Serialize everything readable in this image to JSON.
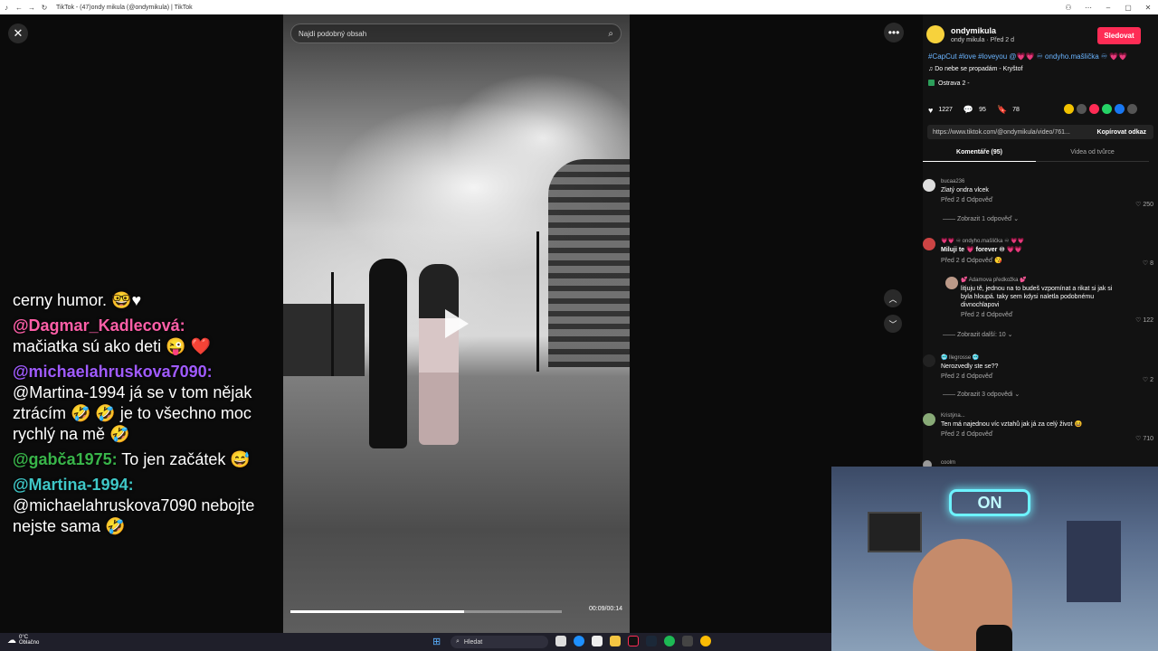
{
  "browser": {
    "title": "TikTok - (47)ondy mikula (@ondymikula) | TikTok"
  },
  "chat": [
    {
      "user": "",
      "text": "cerny humor. 🤓♥",
      "color": "#ffffff"
    },
    {
      "user": "@Dagmar_Kadlecová:",
      "text": "mačiatka sú ako deti 😜 ❤️",
      "color": "#ff5fa8"
    },
    {
      "user": "@michaelahruskova7090:",
      "text": " @Martina-1994 já se v tom nějak ztrácím 🤣 🤣 je to všechno moc rychlý na mě 🤣",
      "color": "#a05bff"
    },
    {
      "user": "@gabča1975:",
      "text": " To jen začátek 😅",
      "color": "#39b54a"
    },
    {
      "user": "@Martina-1994:",
      "text": " @michaelahruskova7090 nebojte nejste sama 🤣",
      "color": "#3fc7c7"
    }
  ],
  "video": {
    "search_placeholder": "Najdi podobný obsah",
    "time": "00:09/00:14",
    "progress": 0.64
  },
  "author": {
    "name": "ondymikula",
    "sub": "ondy mikula · Před 2 d",
    "follow_label": "Sledovat"
  },
  "caption": "#CapCut #love #loveyou @💗💗 ♾ ondyho.mašlička ♾ 💗💗",
  "music": "♫  Do nebe se propadám - Kryštof",
  "location": "Ostrava  2 -",
  "stats": {
    "likes": "1227",
    "comments": "95",
    "saves": "78"
  },
  "link": {
    "url": "https://www.tiktok.com/@ondymikula/video/761...",
    "copy_label": "Kopírovat odkaz"
  },
  "tabs": {
    "comments": "Komentáře (95)",
    "videos": "Videa od tvůrce"
  },
  "comments": [
    {
      "user": "bucaa236",
      "text": "Zlatý ondra vlcek",
      "meta": "Před 2 d    Odpověď",
      "likes": "♡ 250",
      "replies": "—— Zobrazit 1 odpověď ⌄"
    },
    {
      "user": "💗💗 ♾ ondyho.mašlička ♾ 💗💗",
      "text": "Miluji te 💗 forever ♾ 💗💗",
      "meta": "Před 2 d    Odpověď  😘",
      "likes": "♡ 8",
      "replies": ""
    },
    {
      "user": "💕 Adamova předkožka 💕",
      "text": "litjuju tě, jednou na to budeš vzpomínat a rikat si jak si byla hloupá. taky sem kdysi naletla podobnému divnochlapovi",
      "meta": "Před 2 d    Odpověď",
      "likes": "♡ 122",
      "replies": "—— Zobrazit další: 10 ⌄"
    },
    {
      "user": "🥶 llegrosse 🥶",
      "text": "Nerozvedly ste se??",
      "meta": "Před 2 d    Odpověď",
      "likes": "♡ 2",
      "replies": "—— Zobrazit 3 odpovědi ⌄"
    },
    {
      "user": "Kristýna...",
      "text": "Ten má najednou víc vztahů jak já za celý život 😆",
      "meta": "Před 2 d    Odpověď",
      "likes": "♡ 710",
      "replies": ""
    },
    {
      "user": "coolm",
      "text": "",
      "meta": "",
      "likes": "",
      "replies": ""
    }
  ],
  "taskbar": {
    "temp": "0°C",
    "weather": "Oblačno",
    "search": "Hledat"
  },
  "webcam": {
    "neon_text": "ON"
  }
}
